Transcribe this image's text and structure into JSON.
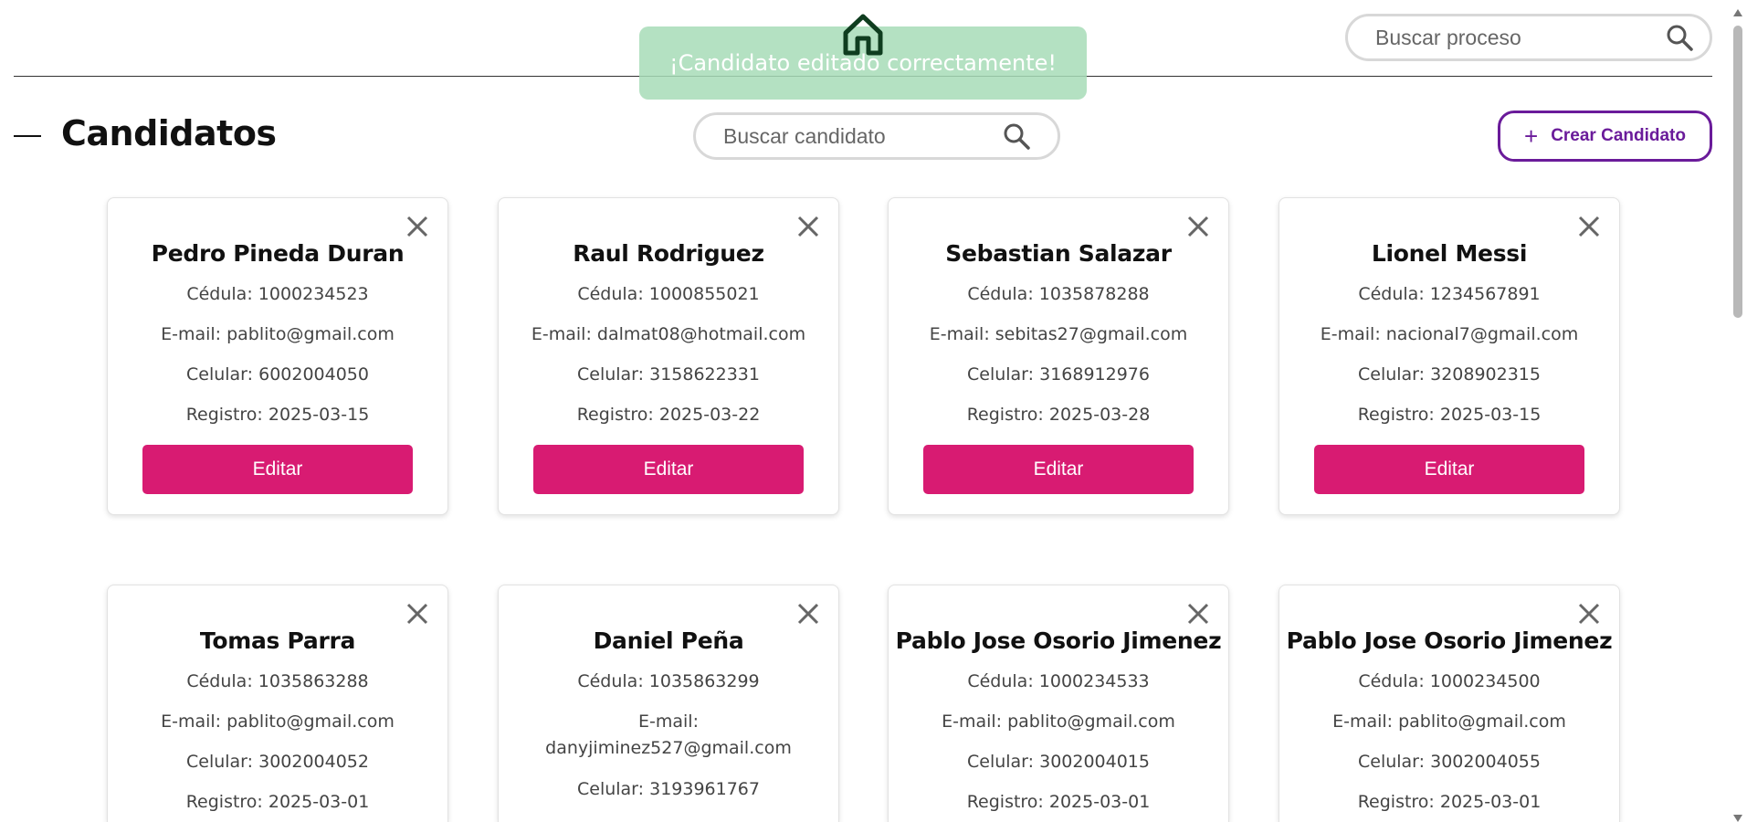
{
  "header": {
    "search_process_placeholder": "Buscar proceso",
    "home_icon": "home-icon",
    "search_icon": "search-icon"
  },
  "toast": {
    "message": "¡Candidato editado correctamente!",
    "color": "#a7dcb7"
  },
  "main": {
    "title": "Candidatos",
    "search_candidate_placeholder": "Buscar candidato",
    "create_button": {
      "icon": "+",
      "label": "Crear Candidato"
    }
  },
  "colors": {
    "accent_purple": "#6a1b9a",
    "edit_button": "#d81b72"
  },
  "candidates": [
    {
      "name": "Pedro Pineda Duran",
      "cedula": "Cédula: 1000234523",
      "email": "E-mail: pablito@gmail.com",
      "celular": "Celular: 6002004050",
      "registro": "Registro: 2025-03-15",
      "edit_label": "Editar"
    },
    {
      "name": "Raul Rodriguez",
      "cedula": "Cédula: 1000855021",
      "email": "E-mail: dalmat08@hotmail.com",
      "celular": "Celular: 3158622331",
      "registro": "Registro: 2025-03-22",
      "edit_label": "Editar"
    },
    {
      "name": "Sebastian Salazar",
      "cedula": "Cédula: 1035878288",
      "email": "E-mail: sebitas27@gmail.com",
      "celular": "Celular: 3168912976",
      "registro": "Registro: 2025-03-28",
      "edit_label": "Editar"
    },
    {
      "name": "Lionel Messi",
      "cedula": "Cédula: 1234567891",
      "email": "E-mail: nacional7@gmail.com",
      "celular": "Celular: 3208902315",
      "registro": "Registro: 2025-03-15",
      "edit_label": "Editar"
    },
    {
      "name": "Tomas Parra",
      "cedula": "Cédula: 1035863288",
      "email": "E-mail: pablito@gmail.com",
      "celular": "Celular: 3002004052",
      "registro": "Registro: 2025-03-01"
    },
    {
      "name": "Daniel Peña",
      "cedula": "Cédula: 1035863299",
      "email_label": "E-mail:",
      "email_value": "danyjiminez527@gmail.com",
      "celular": "Celular: 3193961767"
    },
    {
      "name": "Pablo Jose Osorio Jimenez",
      "cedula": "Cédula: 1000234533",
      "email": "E-mail: pablito@gmail.com",
      "celular": "Celular: 3002004015",
      "registro": "Registro: 2025-03-01"
    },
    {
      "name": "Pablo Jose Osorio Jimenez",
      "cedula": "Cédula: 1000234500",
      "email": "E-mail: pablito@gmail.com",
      "celular": "Celular: 3002004055",
      "registro": "Registro: 2025-03-01"
    }
  ]
}
